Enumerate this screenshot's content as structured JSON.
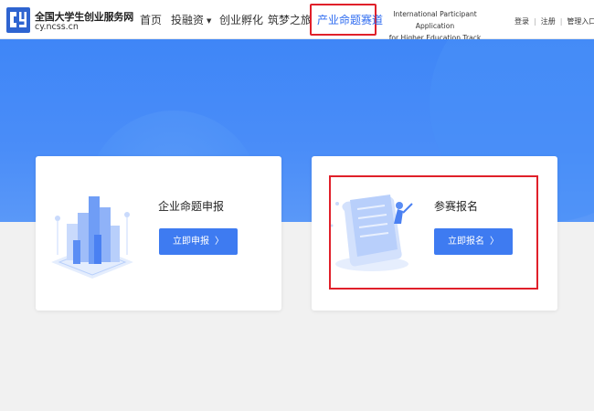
{
  "header": {
    "site_name": "全国大学生创业服务网",
    "site_url": "cy.ncss.cn",
    "nav": [
      {
        "label": "首页"
      },
      {
        "label": "投融资"
      },
      {
        "label": "创业孵化"
      },
      {
        "label": "筑梦之旅"
      }
    ],
    "nav_active": "产业命题赛道",
    "intl_line1": "International Participant Application",
    "intl_line2": "for Higher Education Track",
    "login": "登录",
    "register": "注册",
    "admin": "管理入口"
  },
  "cards": [
    {
      "title": "企业命题申报",
      "button": "立即申报"
    },
    {
      "title": "参赛报名",
      "button": "立即报名"
    }
  ],
  "colors": {
    "primary": "#3e7bf1",
    "banner": "#4a8df8",
    "active_nav": "#2f6cf0",
    "highlight": "#e0202a",
    "logo": "#2e64d0"
  },
  "icons": {
    "logo": "cy-logo-icon",
    "caret": "caret-down-icon",
    "chevron": "chevron-right-icon"
  }
}
